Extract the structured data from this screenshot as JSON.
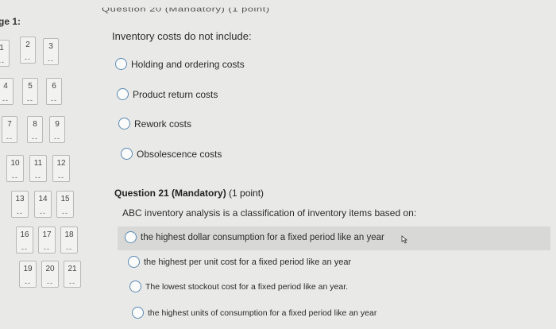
{
  "page": {
    "label": "ge 1:"
  },
  "nav": {
    "items": [
      {
        "num": "1",
        "dash": "--"
      },
      {
        "num": "2",
        "dash": "--"
      },
      {
        "num": "3",
        "dash": "--"
      },
      {
        "num": "4",
        "dash": "--"
      },
      {
        "num": "5",
        "dash": "--"
      },
      {
        "num": "6",
        "dash": "--"
      },
      {
        "num": "7",
        "dash": "--"
      },
      {
        "num": "8",
        "dash": "--"
      },
      {
        "num": "9",
        "dash": "--"
      },
      {
        "num": "10",
        "dash": "--"
      },
      {
        "num": "11",
        "dash": "--"
      },
      {
        "num": "12",
        "dash": "--"
      },
      {
        "num": "13",
        "dash": "--"
      },
      {
        "num": "14",
        "dash": "--"
      },
      {
        "num": "15",
        "dash": "--"
      },
      {
        "num": "16",
        "dash": "--"
      },
      {
        "num": "17",
        "dash": "--"
      },
      {
        "num": "18",
        "dash": "--"
      },
      {
        "num": "19",
        "dash": "--"
      },
      {
        "num": "20",
        "dash": "--"
      },
      {
        "num": "21",
        "dash": "--"
      }
    ]
  },
  "q20": {
    "header": "Question 20 (Mandatory) (1 point)",
    "text": "Inventory costs do not include:",
    "options": [
      "Holding and ordering costs",
      "Product return costs",
      "Rework costs",
      "Obsolescence costs"
    ]
  },
  "q21": {
    "title": "Question 21 (Mandatory)",
    "points": "(1 point)",
    "text": "ABC inventory analysis is a classification of inventory items based on:",
    "options": [
      "the highest dollar consumption for a fixed period like an year",
      "the highest per unit cost for a fixed period like an year",
      "The lowest stockout cost for a fixed period like an year.",
      "the highest units of consumption for a fixed period like an year"
    ]
  }
}
